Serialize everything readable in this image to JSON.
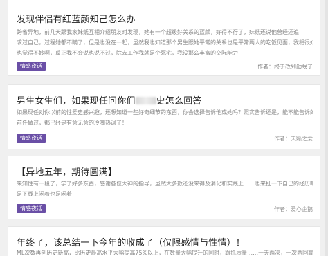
{
  "posts": [
    {
      "title": "发现伴侣有红蓝颜知己怎么办",
      "excerpt_lines": [
        "跨省异地，前几天跟我家妹纸互相介绍朋友时发现，她有一个超级好关系的蓝颜，好得不行了，妹纸还说他曾经还追",
        "求过自己，过程她都不瞒了，但是也没在一起，虽然我也知道那个男生跟她平常的关系也是平常两人的吃饭见面，我相很妹纸自己",
        "也觉得不妙啊，反正我不会说也说不过，除去工作我就是个死宅，我没那么丰富的交际能力"
      ],
      "tag": "情感夜话",
      "author": "作者：终于改到勤眠了"
    },
    {
      "title_before": "男生女生们，如果现任问你们",
      "title_after": "史怎么回答",
      "excerpt_lines": [
        "如果现任对你以前的性爱史感兴趣，还想知道一些好奇细节的东西，你会选择告诉他或她吗？照实告诉还是，能不能告诉的呢，感觉告诉现任和",
        "前任做过，都已经是有意无意的冷嘲热讽了！"
      ],
      "tag": "情感夜话",
      "author": "作者：天籁之爱"
    },
    {
      "title": "【异地五年，期待圆满】",
      "excerpt_lines": [
        "来知性有一段了，学了好多东西，感谢各位大神的指导，虽然大多数还没来得及消化和实践上……也来扯一下自己的经历吧，只",
        "是下线上闲着也是闲着"
      ],
      "tag": "情感夜话",
      "author": "作者：爱心企鹅"
    },
    {
      "title": "年终了，该总结一下今年的收成了（仅限感情与性情）！",
      "excerpt_lines": [
        "ML次数再创历史新高，比历史最高水平大幅提高75%以上，在数量大幅提升的同时，跟抓质量……一天两次，一次两回高"
      ]
    }
  ]
}
